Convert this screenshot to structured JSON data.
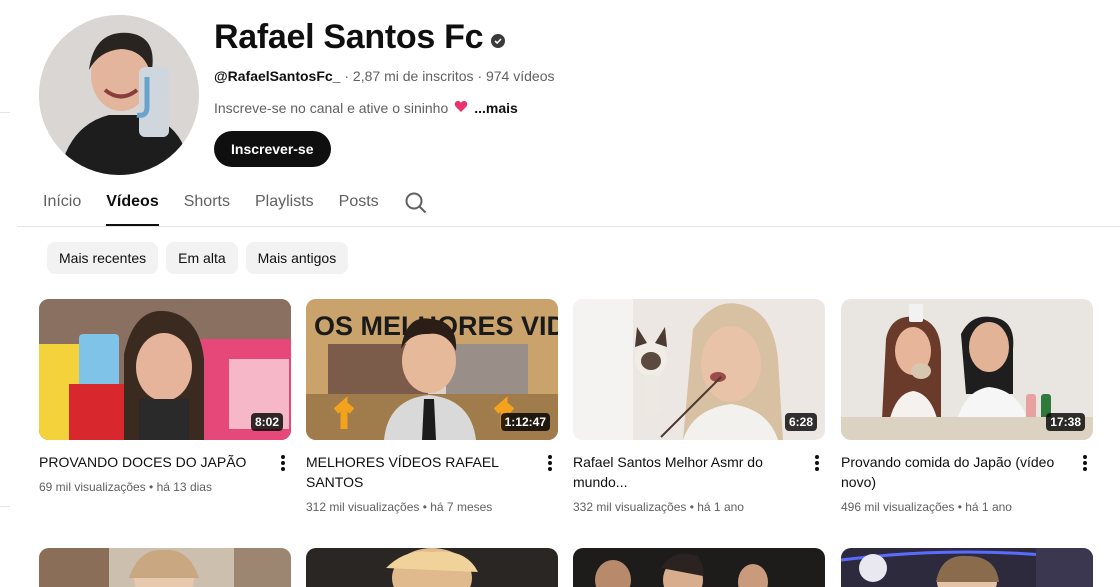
{
  "channel": {
    "name": "Rafael Santos Fc",
    "handle": "@RafaelSantosFc_",
    "subscribers": "· 2,87 mi de inscritos",
    "videos_count": "· 974 vídeos",
    "description": "Inscreve-se no canal e ative o sininho",
    "more": "...mais",
    "subscribe_label": "Inscrever-se"
  },
  "tabs": [
    {
      "label": "Início"
    },
    {
      "label": "Vídeos"
    },
    {
      "label": "Shorts"
    },
    {
      "label": "Playlists"
    },
    {
      "label": "Posts"
    }
  ],
  "chips": [
    {
      "label": "Mais recentes"
    },
    {
      "label": "Em alta"
    },
    {
      "label": "Mais antigos"
    }
  ],
  "videos": [
    {
      "title": "PROVANDO DOCES DO JAPÃO",
      "meta": "69 mil visualizações • há 13 dias",
      "duration": "8:02"
    },
    {
      "title": "MELHORES VÍDEOS RAFAEL SANTOS",
      "meta": "312 mil visualizações • há 7 meses",
      "duration": "1:12:47",
      "thumb_text": "OS MELHORES VIDEOS"
    },
    {
      "title": "Rafael Santos Melhor Asmr do mundo...",
      "meta": "332 mil visualizações • há 1 ano",
      "duration": "6:28"
    },
    {
      "title": "Provando comida do Japão (vídeo novo)",
      "meta": "496 mil visualizações • há 1 ano",
      "duration": "17:38"
    }
  ]
}
